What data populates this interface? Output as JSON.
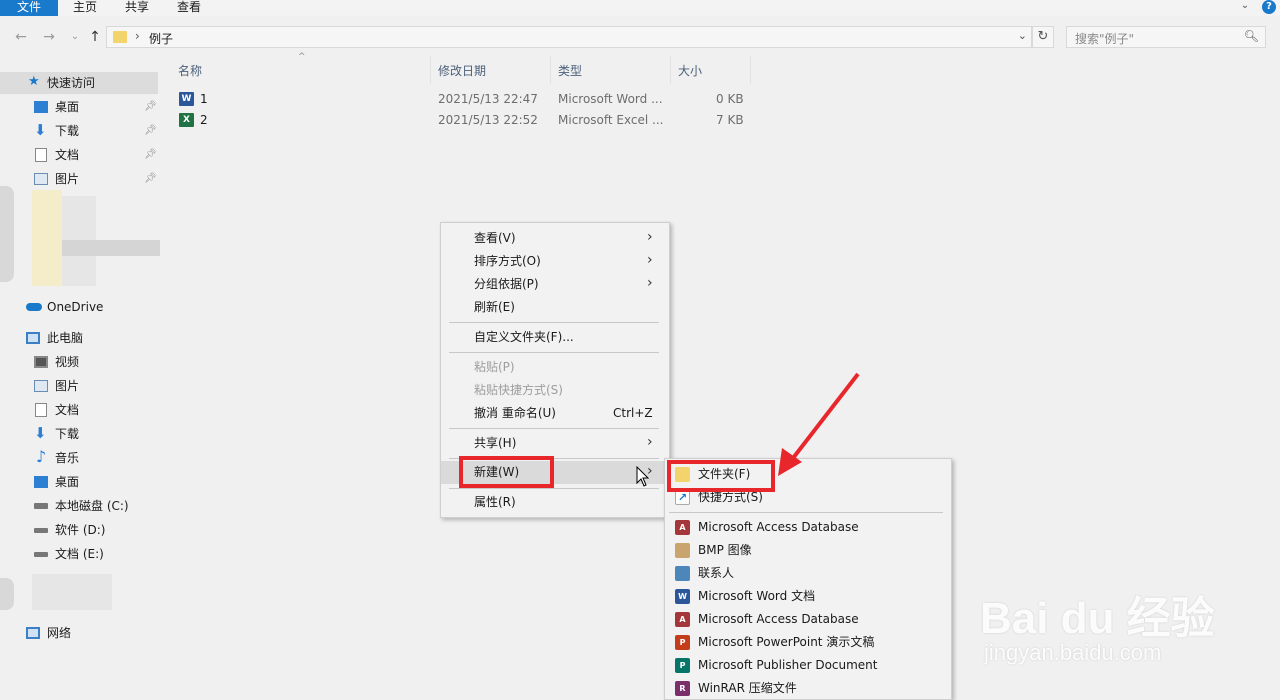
{
  "ribbon": {
    "tabs": [
      "文件",
      "主页",
      "共享",
      "查看"
    ],
    "help": "?",
    "expand": "⌄"
  },
  "address": {
    "back": "←",
    "forward": "→",
    "recent": "⌄",
    "up": "↑",
    "separator": "›",
    "path": "例子",
    "dropdown": "⌄",
    "refresh": "↻"
  },
  "search": {
    "placeholder": "搜索\"例子\""
  },
  "sidebar": {
    "quick_access": "快速访问",
    "quick_items": [
      {
        "label": "桌面",
        "icon": "desktop-icon"
      },
      {
        "label": "下载",
        "icon": "download-icon"
      },
      {
        "label": "文档",
        "icon": "document-icon"
      },
      {
        "label": "图片",
        "icon": "picture-icon"
      }
    ],
    "onedrive": "OneDrive",
    "this_pc": "此电脑",
    "pc_items": [
      {
        "label": "视频",
        "icon": "video-icon"
      },
      {
        "label": "图片",
        "icon": "picture-icon"
      },
      {
        "label": "文档",
        "icon": "document-icon"
      },
      {
        "label": "下载",
        "icon": "download-icon"
      },
      {
        "label": "音乐",
        "icon": "music-icon"
      },
      {
        "label": "桌面",
        "icon": "desktop-icon"
      },
      {
        "label": "本地磁盘 (C:)",
        "icon": "drive-c-icon"
      },
      {
        "label": "软件 (D:)",
        "icon": "drive-icon"
      },
      {
        "label": "文档 (E:)",
        "icon": "drive-icon"
      }
    ],
    "network": "网络"
  },
  "columns": {
    "name": "名称",
    "modified": "修改日期",
    "type": "类型",
    "size": "大小"
  },
  "files": [
    {
      "name": "1",
      "modified": "2021/5/13 22:47",
      "type": "Microsoft Word ...",
      "size": "0 KB",
      "icon": "word-doc-icon",
      "glyph": "W"
    },
    {
      "name": "2",
      "modified": "2021/5/13 22:52",
      "type": "Microsoft Excel ...",
      "size": "7 KB",
      "icon": "excel-doc-icon",
      "glyph": "X"
    }
  ],
  "context_menu": {
    "view": "查看(V)",
    "sort": "排序方式(O)",
    "group": "分组依据(P)",
    "refresh": "刷新(E)",
    "customize": "自定义文件夹(F)...",
    "paste": "粘贴(P)",
    "paste_shortcut": "粘贴快捷方式(S)",
    "undo": "撤消 重命名(U)",
    "undo_shortcut": "Ctrl+Z",
    "share": "共享(H)",
    "new": "新建(W)",
    "properties": "属性(R)"
  },
  "new_submenu": {
    "folder": "文件夹(F)",
    "shortcut": "快捷方式(S)",
    "items": [
      {
        "label": "Microsoft Access Database",
        "icon": "access-icon",
        "color": "#a4373a",
        "glyph": "A"
      },
      {
        "label": "BMP 图像",
        "icon": "bmp-image-icon",
        "color": "#c9a46e",
        "glyph": ""
      },
      {
        "label": "联系人",
        "icon": "contact-icon",
        "color": "#4d86b8",
        "glyph": ""
      },
      {
        "label": "Microsoft Word 文档",
        "icon": "word-icon",
        "color": "#2b579a",
        "glyph": "W"
      },
      {
        "label": "Microsoft Access Database",
        "icon": "access-icon",
        "color": "#a4373a",
        "glyph": "A"
      },
      {
        "label": "Microsoft PowerPoint 演示文稿",
        "icon": "powerpoint-icon",
        "color": "#c43e1c",
        "glyph": "P"
      },
      {
        "label": "Microsoft Publisher Document",
        "icon": "publisher-icon",
        "color": "#077568",
        "glyph": "P"
      },
      {
        "label": "WinRAR 压缩文件",
        "icon": "winrar-icon",
        "color": "#7a2f6b",
        "glyph": "R"
      }
    ]
  },
  "watermark": {
    "brand": "Bai du 经验",
    "url": "jingyan.baidu.com"
  },
  "colors": {
    "accent": "#1979ca",
    "highlight": "#e8272d",
    "menu_bg": "#f2f2f2"
  }
}
